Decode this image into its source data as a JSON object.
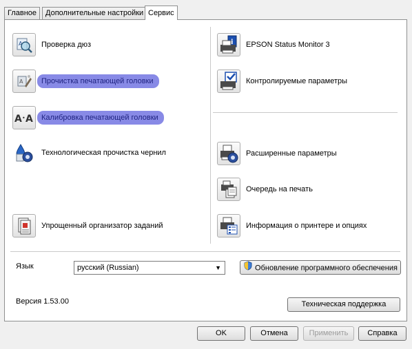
{
  "tabs": [
    {
      "label": "Главное"
    },
    {
      "label": "Дополнительные настройки"
    },
    {
      "label": "Сервис"
    }
  ],
  "left_items": [
    {
      "label": "Проверка дюз",
      "icon": "nozzle-check-icon"
    },
    {
      "label": "Прочистка печатающей головки",
      "icon": "head-cleaning-icon"
    },
    {
      "label": "Калибровка печатающей головки",
      "icon": "head-alignment-icon"
    },
    {
      "label": "Технологическая прочистка чернил",
      "icon": "power-ink-flushing-icon"
    },
    {
      "label": "Упрощенный организатор заданий",
      "icon": "job-arranger-icon"
    }
  ],
  "right_items": [
    {
      "label": "EPSON Status Monitor 3",
      "icon": "status-monitor-icon"
    },
    {
      "label": "Контролируемые параметры",
      "icon": "monitoring-preferences-icon"
    },
    {
      "label": "Расширенные параметры",
      "icon": "extended-settings-icon"
    },
    {
      "label": "Очередь на печать",
      "icon": "print-queue-icon"
    },
    {
      "label": "Информация о принтере и опциях",
      "icon": "printer-info-icon"
    }
  ],
  "language": {
    "label": "Язык",
    "value": "русский (Russian)"
  },
  "update_button": "Обновление программного обеспечения",
  "version": "Версия 1.53.00",
  "support_button": "Техническая поддержка",
  "dialog_buttons": {
    "ok": "OK",
    "cancel": "Отмена",
    "apply": "Применить",
    "help": "Справка"
  },
  "colors": {
    "highlight": "#7b7de3",
    "panel": "#ffffff",
    "window": "#f0f0f0"
  }
}
